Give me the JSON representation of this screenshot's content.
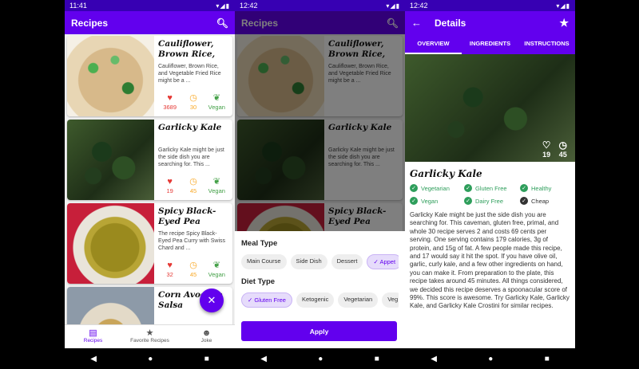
{
  "screen1": {
    "status": {
      "time": "11:41"
    },
    "appbar": {
      "title": "Recipes"
    },
    "cards": [
      {
        "title": "Cauliflower, Brown Rice, an...",
        "desc": "Cauliflower, Brown Rice, and Vegetable Fried Rice might be a ...",
        "likes": "3689",
        "minutes": "30",
        "vegan": "Vegan"
      },
      {
        "title": "Garlicky Kale",
        "desc": "Garlicky Kale might be just the side dish you are searching for. This ...",
        "likes": "19",
        "minutes": "45",
        "vegan": "Vegan"
      },
      {
        "title": "Spicy Black-Eyed Pea Curry with...",
        "desc": "The recipe Spicy Black-Eyed Pea Curry with Swiss Chard and ...",
        "likes": "32",
        "minutes": "45",
        "vegan": "Vegan"
      },
      {
        "title": "Corn Avocado Salsa",
        "desc": "",
        "likes": "",
        "minutes": "",
        "vegan": ""
      }
    ],
    "bottomnav": {
      "recipes": "Recipes",
      "favorites": "Favorite Recipes",
      "joke": "Joke"
    }
  },
  "screen2": {
    "status": {
      "time": "12:42"
    },
    "appbar": {
      "title": "Recipes"
    },
    "sheet": {
      "meal_type_title": "Meal Type",
      "meal_types": [
        "Main Course",
        "Side Dish",
        "Dessert",
        "Appet"
      ],
      "diet_type_title": "Diet Type",
      "diet_types": [
        "Gluten Free",
        "Ketogenic",
        "Vegetarian",
        "Veg"
      ],
      "apply_label": "Apply"
    }
  },
  "screen3": {
    "status": {
      "time": "12:42"
    },
    "appbar": {
      "title": "Details"
    },
    "tabs": [
      "OVERVIEW",
      "INGREDIENTS",
      "INSTRUCTIONS"
    ],
    "hero": {
      "likes": "19",
      "minutes": "45"
    },
    "title": "Garlicky Kale",
    "tags": [
      "Vegetarian",
      "Gluten Free",
      "Healthy",
      "Vegan",
      "Dairy Free",
      "Cheap"
    ],
    "summary": "Garlicky Kale might be just the side dish you are searching for. This caveman, gluten free, primal, and whole 30 recipe serves 2 and costs 69 cents per serving. One serving contains 179 calories, 3g of protein, and 15g of fat. A few people made this recipe, and 17 would say it hit the spot. If you have olive oil, garlic, curly kale, and a few other ingredients on hand, you can make it. From preparation to the plate, this recipe takes around 45 minutes. All things considered, we decided this recipe deserves a spoonacular score of 99%. This score is awesome. Try Garlicky Kale, Garlicky Kale, and Garlicky Kale Crostini for similar recipes."
  },
  "colors": {
    "primary": "#6200ee",
    "primary_dark": "#3700b3",
    "heart": "#e53935",
    "clock": "#f9a825",
    "vegan": "#43a047"
  }
}
